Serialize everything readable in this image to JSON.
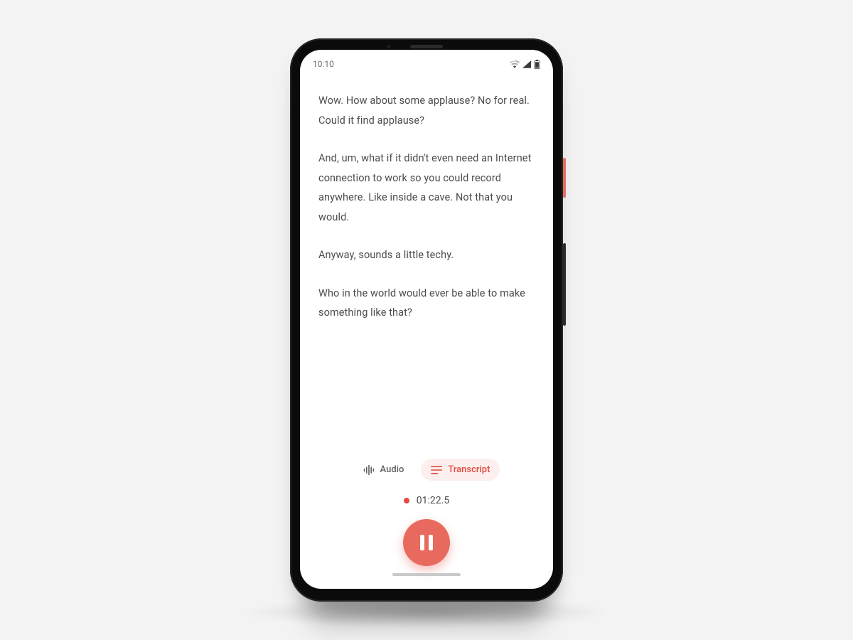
{
  "status_bar": {
    "time": "10:10",
    "wifi_icon": "wifi",
    "signal_icon": "cellular",
    "battery_icon": "battery"
  },
  "transcript": {
    "paragraphs": [
      "Wow. How about some applause? No for real. Could it find applause?",
      "And, um, what if it didn't even need an Internet connection to work so you could record anywhere. Like inside a cave. Not that you would.",
      "Anyway, sounds a little techy.",
      "Who in the world would ever be able to make something like that?"
    ]
  },
  "tabs": {
    "audio_label": "Audio",
    "transcript_label": "Transcript",
    "active": "transcript"
  },
  "recording": {
    "elapsed": "01:22.5"
  },
  "colors": {
    "accent": "#e24a3f",
    "accent_soft": "#e86a5e",
    "text": "#4c4c4c"
  }
}
